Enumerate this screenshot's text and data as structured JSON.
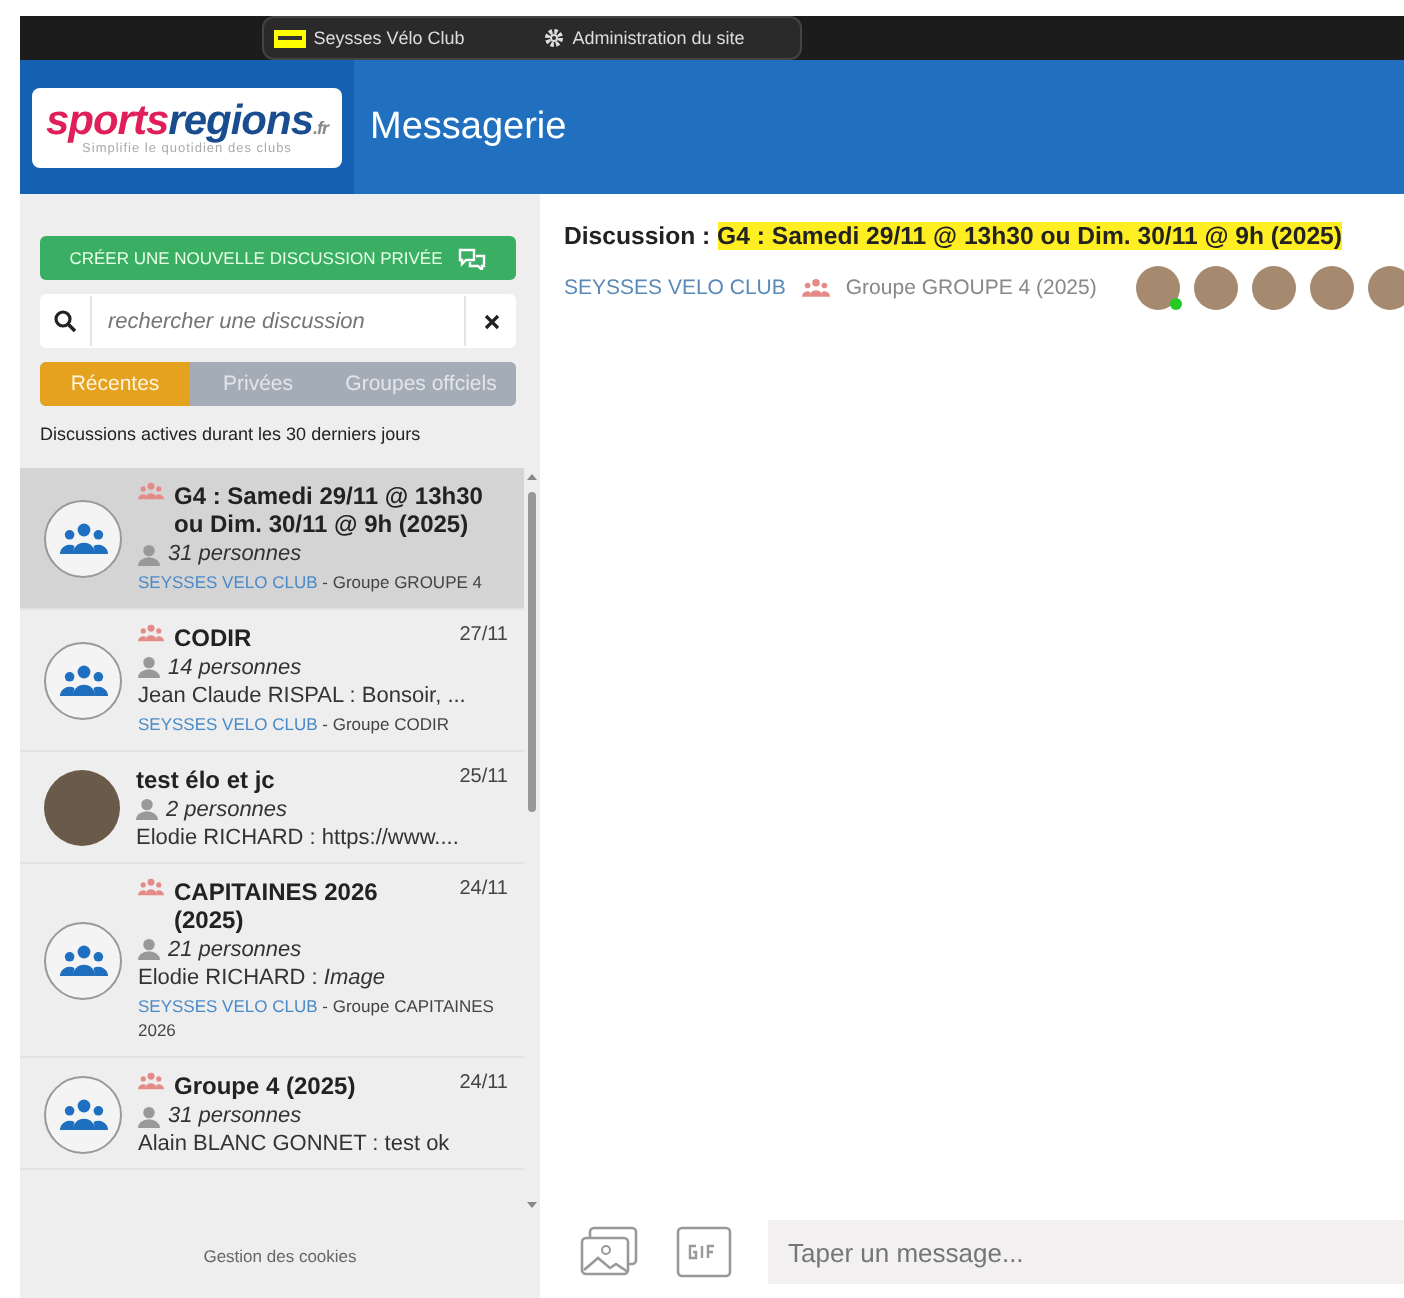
{
  "top_bar": {
    "items": [
      {
        "kind": "club",
        "label": "Seysses Vélo Club"
      },
      {
        "kind": "admin",
        "label": "Administration du site"
      }
    ]
  },
  "header": {
    "logo_part_1": "sports",
    "logo_part_2": "regions",
    "logo_suffix": ".fr",
    "logo_tagline": "Simplifie le quotidien des clubs",
    "title": "Messagerie"
  },
  "sidebar": {
    "new_button": "CRÉER UNE NOUVELLE DISCUSSION PRIVÉE",
    "search": {
      "placeholder": "rechercher une discussion"
    },
    "tabs": [
      {
        "label": "Récentes",
        "selected": true
      },
      {
        "label": "Privées",
        "selected": false
      },
      {
        "label": "Groupes offciels",
        "selected": false
      }
    ],
    "filter_note": "Discussions actives durant les 30 derniers jours",
    "discussions": [
      {
        "kind": "group",
        "title": "G4 : Samedi 29/11 @ 13h30 ou Dim. 30/11 @ 9h (2025)",
        "members": "31 personnes",
        "club": "SEYSSES VELO CLUB",
        "group": "Groupe GROUPE 4",
        "selected": true
      },
      {
        "kind": "group",
        "title": "CODIR",
        "date": "27/11",
        "members": "14 personnes",
        "last_message": "Jean Claude RISPAL :  Bonsoir, ...",
        "club": "SEYSSES VELO CLUB",
        "group": "Groupe CODIR",
        "selected": false
      },
      {
        "kind": "private",
        "title": "test élo et jc",
        "date": "25/11",
        "members": "2 personnes",
        "last_message": "Elodie RICHARD :  https://www....",
        "selected": false
      },
      {
        "kind": "group",
        "title": "CAPITAINES 2026 (2025)",
        "date": "24/11",
        "members": "21 personnes",
        "last_message": "Elodie RICHARD :  *Image*",
        "club": "SEYSSES VELO CLUB",
        "group": "Groupe CAPITAINES 2026",
        "selected": false
      },
      {
        "kind": "group",
        "title": "Groupe 4 (2025)",
        "date": "24/11",
        "members": "31 personnes",
        "last_message": "Alain BLANC GONNET :  test ok",
        "selected": false
      }
    ],
    "org_separator": "-",
    "footer": "Gestion des cookies"
  },
  "conversation": {
    "title_prefix": "Discussion :",
    "title": "G4 : Samedi 29/11 @ 13h30 ou Dim. 30/11 @ 9h (2025)",
    "highlighted": true,
    "club": "SEYSSES VELO CLUB",
    "group": "Groupe GROUPE 4 (2025)",
    "participants": [
      {
        "online": true
      },
      {
        "online": false
      },
      {
        "online": false
      },
      {
        "online": false
      },
      {
        "online": false
      }
    ],
    "composer": {
      "placeholder": "Taper un message..."
    }
  }
}
